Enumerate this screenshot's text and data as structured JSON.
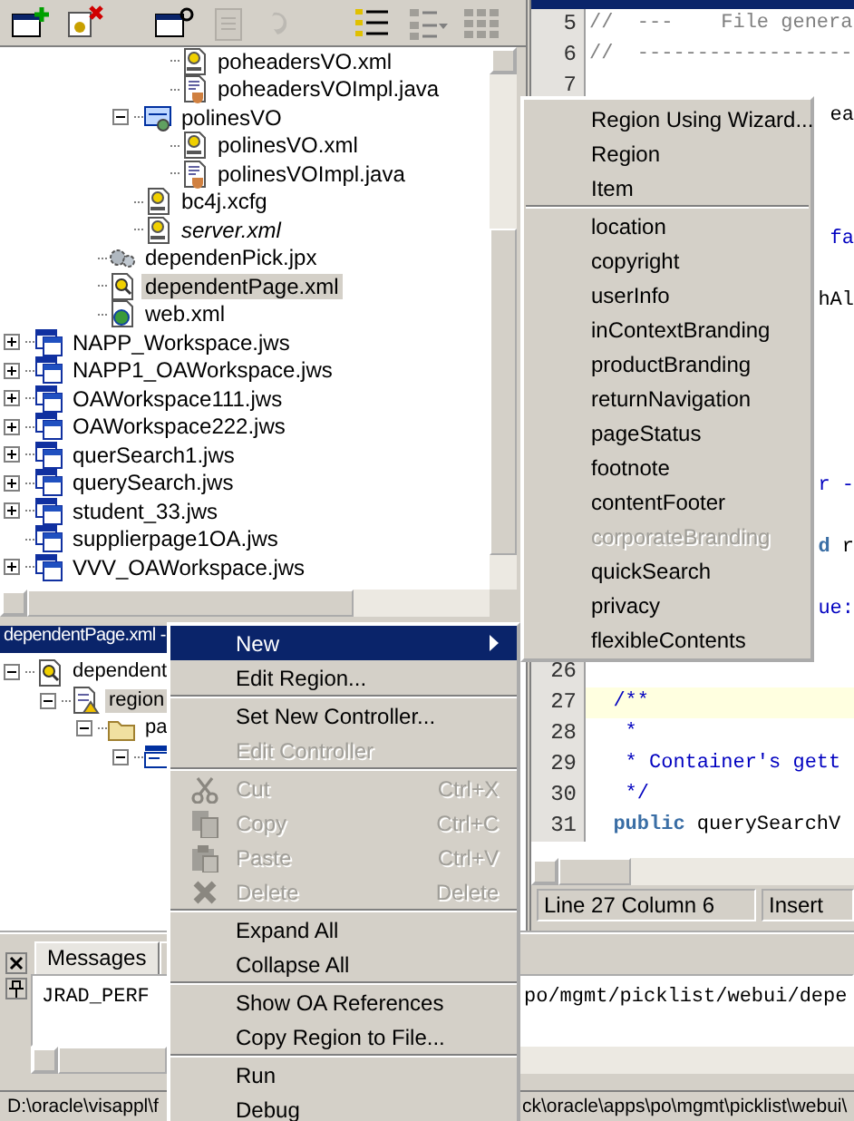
{
  "toolbar": [
    {
      "kind": "new-workspace",
      "disabled": false
    },
    {
      "kind": "remove",
      "disabled": false
    },
    {
      "kind": "new-project",
      "disabled": false
    },
    {
      "kind": "document",
      "disabled": true
    },
    {
      "kind": "undo",
      "disabled": true
    },
    {
      "kind": "list",
      "disabled": false
    },
    {
      "kind": "list-menu",
      "disabled": false
    },
    {
      "kind": "grid",
      "disabled": false
    }
  ],
  "navigator": {
    "items": [
      {
        "children": [
          {
            "children": [
              {
                "children": [
                  {
                    "children": [
                      {
                        "label": "poheadersVO.xml",
                        "kind": "xml",
                        "selected": false,
                        "italic": false
                      },
                      {
                        "label": "poheadersVOImpl.java",
                        "kind": "java",
                        "selected": false,
                        "italic": false
                      }
                    ]
                  },
                  {
                    "label": "polinesVO",
                    "kind": "view-object",
                    "expanded": true,
                    "selected": false,
                    "italic": false,
                    "children": [
                      {
                        "label": "polinesVO.xml",
                        "kind": "xml",
                        "selected": false,
                        "italic": false
                      },
                      {
                        "label": "polinesVOImpl.java",
                        "kind": "java",
                        "selected": false,
                        "italic": false
                      }
                    ]
                  },
                  {
                    "label": "bc4j.xcfg",
                    "kind": "xml",
                    "selected": false,
                    "italic": false
                  },
                  {
                    "label": "server.xml",
                    "kind": "xml",
                    "selected": false,
                    "italic": true
                  }
                ]
              },
              {
                "label": "dependenPick.jpx",
                "kind": "gears",
                "selected": false,
                "italic": false
              },
              {
                "label": "dependentPage.xml",
                "kind": "page",
                "selected": true,
                "italic": false
              },
              {
                "label": "web.xml",
                "kind": "web",
                "selected": false,
                "italic": false
              }
            ]
          }
        ]
      },
      {
        "label": "NAPP_Workspace.jws",
        "kind": "workspace",
        "expanded": false,
        "selected": false,
        "italic": false
      },
      {
        "label": "NAPP1_OAWorkspace.jws",
        "kind": "workspace",
        "expanded": false,
        "selected": false,
        "italic": false
      },
      {
        "label": "OAWorkspace111.jws",
        "kind": "workspace",
        "expanded": false,
        "selected": false,
        "italic": false
      },
      {
        "label": "OAWorkspace222.jws",
        "kind": "workspace",
        "expanded": false,
        "selected": false,
        "italic": false
      },
      {
        "label": "querSearch1.jws",
        "kind": "workspace",
        "expanded": false,
        "selected": false,
        "italic": false
      },
      {
        "label": "querySearch.jws",
        "kind": "workspace",
        "expanded": false,
        "selected": false,
        "italic": false
      },
      {
        "label": "student_33.jws",
        "kind": "workspace",
        "expanded": false,
        "selected": false,
        "italic": false
      },
      {
        "label": "supplierpage1OA.jws",
        "kind": "workspace",
        "selected": false,
        "italic": false
      },
      {
        "label": "VVV_OAWorkspace.jws",
        "kind": "workspace",
        "expanded": false,
        "selected": false,
        "italic": false
      }
    ]
  },
  "structure": {
    "title": "dependentPage.xml -",
    "items": [
      {
        "label": "dependent",
        "kind": "page",
        "expanded": true,
        "selected": false,
        "italic": false,
        "children": [
          {
            "label": "region",
            "kind": "region",
            "expanded": true,
            "selected": true,
            "italic": false,
            "children": [
              {
                "label": "pa",
                "kind": "folder",
                "expanded": true,
                "selected": false,
                "italic": false,
                "children": [
                  {
                    "kind": "item",
                    "expanded": true,
                    "selected": false
                  }
                ]
              }
            ]
          }
        ]
      }
    ]
  },
  "editor": {
    "lines": [
      {
        "number": "5",
        "current": false,
        "segments": [
          {
            "text": "//  ---    File genera",
            "kind": "comment"
          }
        ]
      },
      {
        "number": "6",
        "current": false,
        "segments": [
          {
            "text": "//  ------------------",
            "kind": "comment"
          }
        ]
      },
      {
        "number": "7",
        "current": false
      },
      {
        "current": false,
        "segments": [
          {
            "text": "ea",
            "kind": "plain"
          }
        ]
      },
      {
        "current": false,
        "segments": [
          {
            "text": "fa",
            "kind": "doc"
          }
        ]
      },
      {
        "current": false,
        "segments": [
          {
            "text": "hAl",
            "kind": "plain"
          }
        ]
      },
      {
        "current": false,
        "segments": [
          {
            "text": "r -",
            "kind": "doc"
          }
        ]
      },
      {
        "current": false,
        "segments": [
          {
            "text": "d",
            "kind": "keyword"
          },
          {
            "text": " r",
            "kind": "plain"
          }
        ]
      },
      {
        "current": false,
        "segments": [
          {
            "text": "ue:",
            "kind": "doc"
          }
        ]
      },
      {
        "number": "26",
        "current": false
      },
      {
        "number": "27",
        "current": true,
        "segments": [
          {
            "text": "  /**",
            "kind": "doc"
          }
        ]
      },
      {
        "number": "28",
        "current": false,
        "segments": [
          {
            "text": "   *",
            "kind": "doc"
          }
        ]
      },
      {
        "number": "29",
        "current": false,
        "segments": [
          {
            "text": "   * Container's gett",
            "kind": "doc"
          }
        ]
      },
      {
        "number": "30",
        "current": false,
        "segments": [
          {
            "text": "   */",
            "kind": "doc"
          }
        ]
      },
      {
        "number": "31",
        "current": false,
        "segments": [
          {
            "text": "  public",
            "kind": "keyword"
          },
          {
            "text": " querySearchV",
            "kind": "plain"
          }
        ]
      }
    ],
    "position": "Line 27 Column 6",
    "mode": "Insert"
  },
  "messages": {
    "tabs": [
      {
        "label": "Messages",
        "selected": true
      },
      {
        "selected": false
      }
    ],
    "left_text": "JRAD_PERF",
    "right_text": "po/mgmt/picklist/webui/depe"
  },
  "status_bar": {
    "left_text": "D:\\oracle\\visappl\\f",
    "right_text": "ck\\oracle\\apps\\po\\mgmt\\picklist\\webui\\"
  },
  "context_menu": {
    "items": [
      {
        "kind": "submenu",
        "label": "New",
        "selected": true,
        "disabled": false
      },
      {
        "kind": "command",
        "label": "Edit Region...",
        "selected": false,
        "disabled": false
      },
      {
        "kind": "separator"
      },
      {
        "kind": "command",
        "label": "Set New Controller...",
        "selected": false,
        "disabled": false
      },
      {
        "kind": "command",
        "label": "Edit Controller",
        "selected": false,
        "disabled": true
      },
      {
        "kind": "separator"
      },
      {
        "kind": "cut",
        "label": "Cut",
        "shortcut": "Ctrl+X",
        "selected": false,
        "disabled": true
      },
      {
        "kind": "copy",
        "label": "Copy",
        "shortcut": "Ctrl+C",
        "selected": false,
        "disabled": true
      },
      {
        "kind": "paste",
        "label": "Paste",
        "shortcut": "Ctrl+V",
        "selected": false,
        "disabled": true
      },
      {
        "kind": "delete",
        "label": "Delete",
        "shortcut": "Delete",
        "selected": false,
        "disabled": true
      },
      {
        "kind": "separator"
      },
      {
        "kind": "command",
        "label": "Expand All",
        "selected": false,
        "disabled": false
      },
      {
        "kind": "command",
        "label": "Collapse All",
        "selected": false,
        "disabled": false
      },
      {
        "kind": "separator"
      },
      {
        "kind": "command",
        "label": "Show OA References",
        "selected": false,
        "disabled": false
      },
      {
        "kind": "command",
        "label": "Copy Region to File...",
        "selected": false,
        "disabled": false
      },
      {
        "kind": "separator"
      },
      {
        "kind": "command",
        "label": "Run",
        "selected": false,
        "disabled": false
      },
      {
        "kind": "command",
        "label": "Debug",
        "selected": false,
        "disabled": false
      }
    ]
  },
  "submenu": {
    "items": [
      {
        "kind": "command",
        "label": "Region Using Wizard...",
        "selected": false,
        "disabled": false
      },
      {
        "kind": "command",
        "label": "Region",
        "selected": false,
        "disabled": false
      },
      {
        "kind": "command",
        "label": "Item",
        "selected": false,
        "disabled": false
      },
      {
        "kind": "separator"
      },
      {
        "kind": "command",
        "label": "location",
        "selected": false,
        "disabled": false
      },
      {
        "kind": "command",
        "label": "copyright",
        "selected": false,
        "disabled": false
      },
      {
        "kind": "command",
        "label": "userInfo",
        "selected": false,
        "disabled": false
      },
      {
        "kind": "command",
        "label": "inContextBranding",
        "selected": false,
        "disabled": false
      },
      {
        "kind": "command",
        "label": "productBranding",
        "selected": false,
        "disabled": false
      },
      {
        "kind": "command",
        "label": "returnNavigation",
        "selected": false,
        "disabled": false
      },
      {
        "kind": "command",
        "label": "pageStatus",
        "selected": false,
        "disabled": false
      },
      {
        "kind": "command",
        "label": "footnote",
        "selected": false,
        "disabled": false
      },
      {
        "kind": "command",
        "label": "contentFooter",
        "selected": false,
        "disabled": false
      },
      {
        "kind": "command",
        "label": "corporateBranding",
        "selected": false,
        "disabled": true
      },
      {
        "kind": "command",
        "label": "quickSearch",
        "selected": false,
        "disabled": false
      },
      {
        "kind": "command",
        "label": "privacy",
        "selected": false,
        "disabled": false
      },
      {
        "kind": "command",
        "label": "flexibleContents",
        "selected": false,
        "disabled": false
      }
    ]
  }
}
